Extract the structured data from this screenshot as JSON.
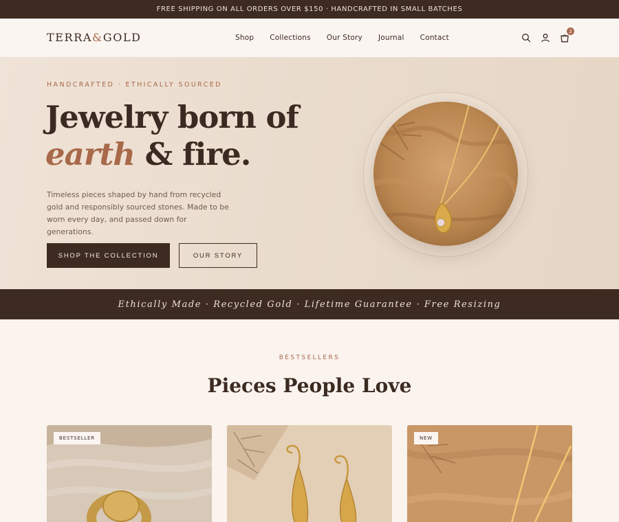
{
  "announcement": "FREE SHIPPING ON ALL ORDERS OVER $150 · HANDCRAFTED IN SMALL BATCHES",
  "brand": {
    "name_part1": "TERRA",
    "amp": "&",
    "name_part2": "GOLD"
  },
  "nav": {
    "items": [
      "Shop",
      "Collections",
      "Our Story",
      "Journal",
      "Contact"
    ],
    "cart_count": "2",
    "icons": [
      "search-icon",
      "account-icon",
      "cart-icon"
    ]
  },
  "hero": {
    "eyebrow": "HANDCRAFTED · ETHICALLY SOURCED",
    "headline_line1": "Jewelry born of",
    "headline_accent": "earth",
    "headline_rest": " & fire.",
    "subtext": "Timeless pieces shaped by hand from recycled gold and responsibly sourced stones. Made to be worn every day, and passed down for generations.",
    "primary_cta": "SHOP THE COLLECTION",
    "secondary_cta": "OUR STORY"
  },
  "values_banner": "Ethically Made · Recycled Gold · Lifetime Guarantee · Free Resizing",
  "bestsellers": {
    "eyebrow": "BESTSELLERS",
    "title": "Pieces People Love",
    "cards": [
      {
        "badge": "BESTSELLER"
      },
      {
        "badge": ""
      },
      {
        "badge": "NEW"
      }
    ]
  },
  "colors": {
    "espresso": "#3d2b21",
    "terracotta": "#a8694a",
    "cream": "#faf3ee",
    "sand": "#eadccd",
    "gold": "#d4a24a"
  }
}
